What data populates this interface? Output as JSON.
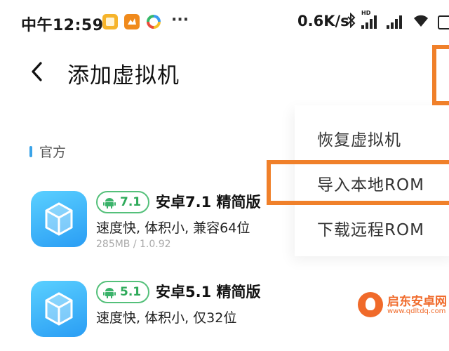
{
  "status_bar": {
    "time": "中午12:59",
    "dots": "···",
    "net_speed": "0.6K/s",
    "hd_label": "HD"
  },
  "header": {
    "title": "添加虚拟机"
  },
  "section": {
    "title": "官方"
  },
  "items": [
    {
      "version": "7.1",
      "title": "安卓7.1 精简版",
      "desc": "速度快, 体积小, 兼容64位",
      "meta": "285MB / 1.0.92"
    },
    {
      "version": "5.1",
      "title": "安卓5.1 精简版",
      "desc": "速度快, 体积小, 仅32位",
      "meta": ""
    }
  ],
  "menu": {
    "items": [
      "恢复虚拟机",
      "导入本地ROM",
      "下载远程ROM"
    ]
  },
  "watermark": {
    "text": "启东安卓网",
    "url": "www.qdltdq.com"
  },
  "colors": {
    "accent_green": "#2faa5a",
    "highlight_orange": "#f0802a",
    "section_marker": "#3aa3e8"
  }
}
